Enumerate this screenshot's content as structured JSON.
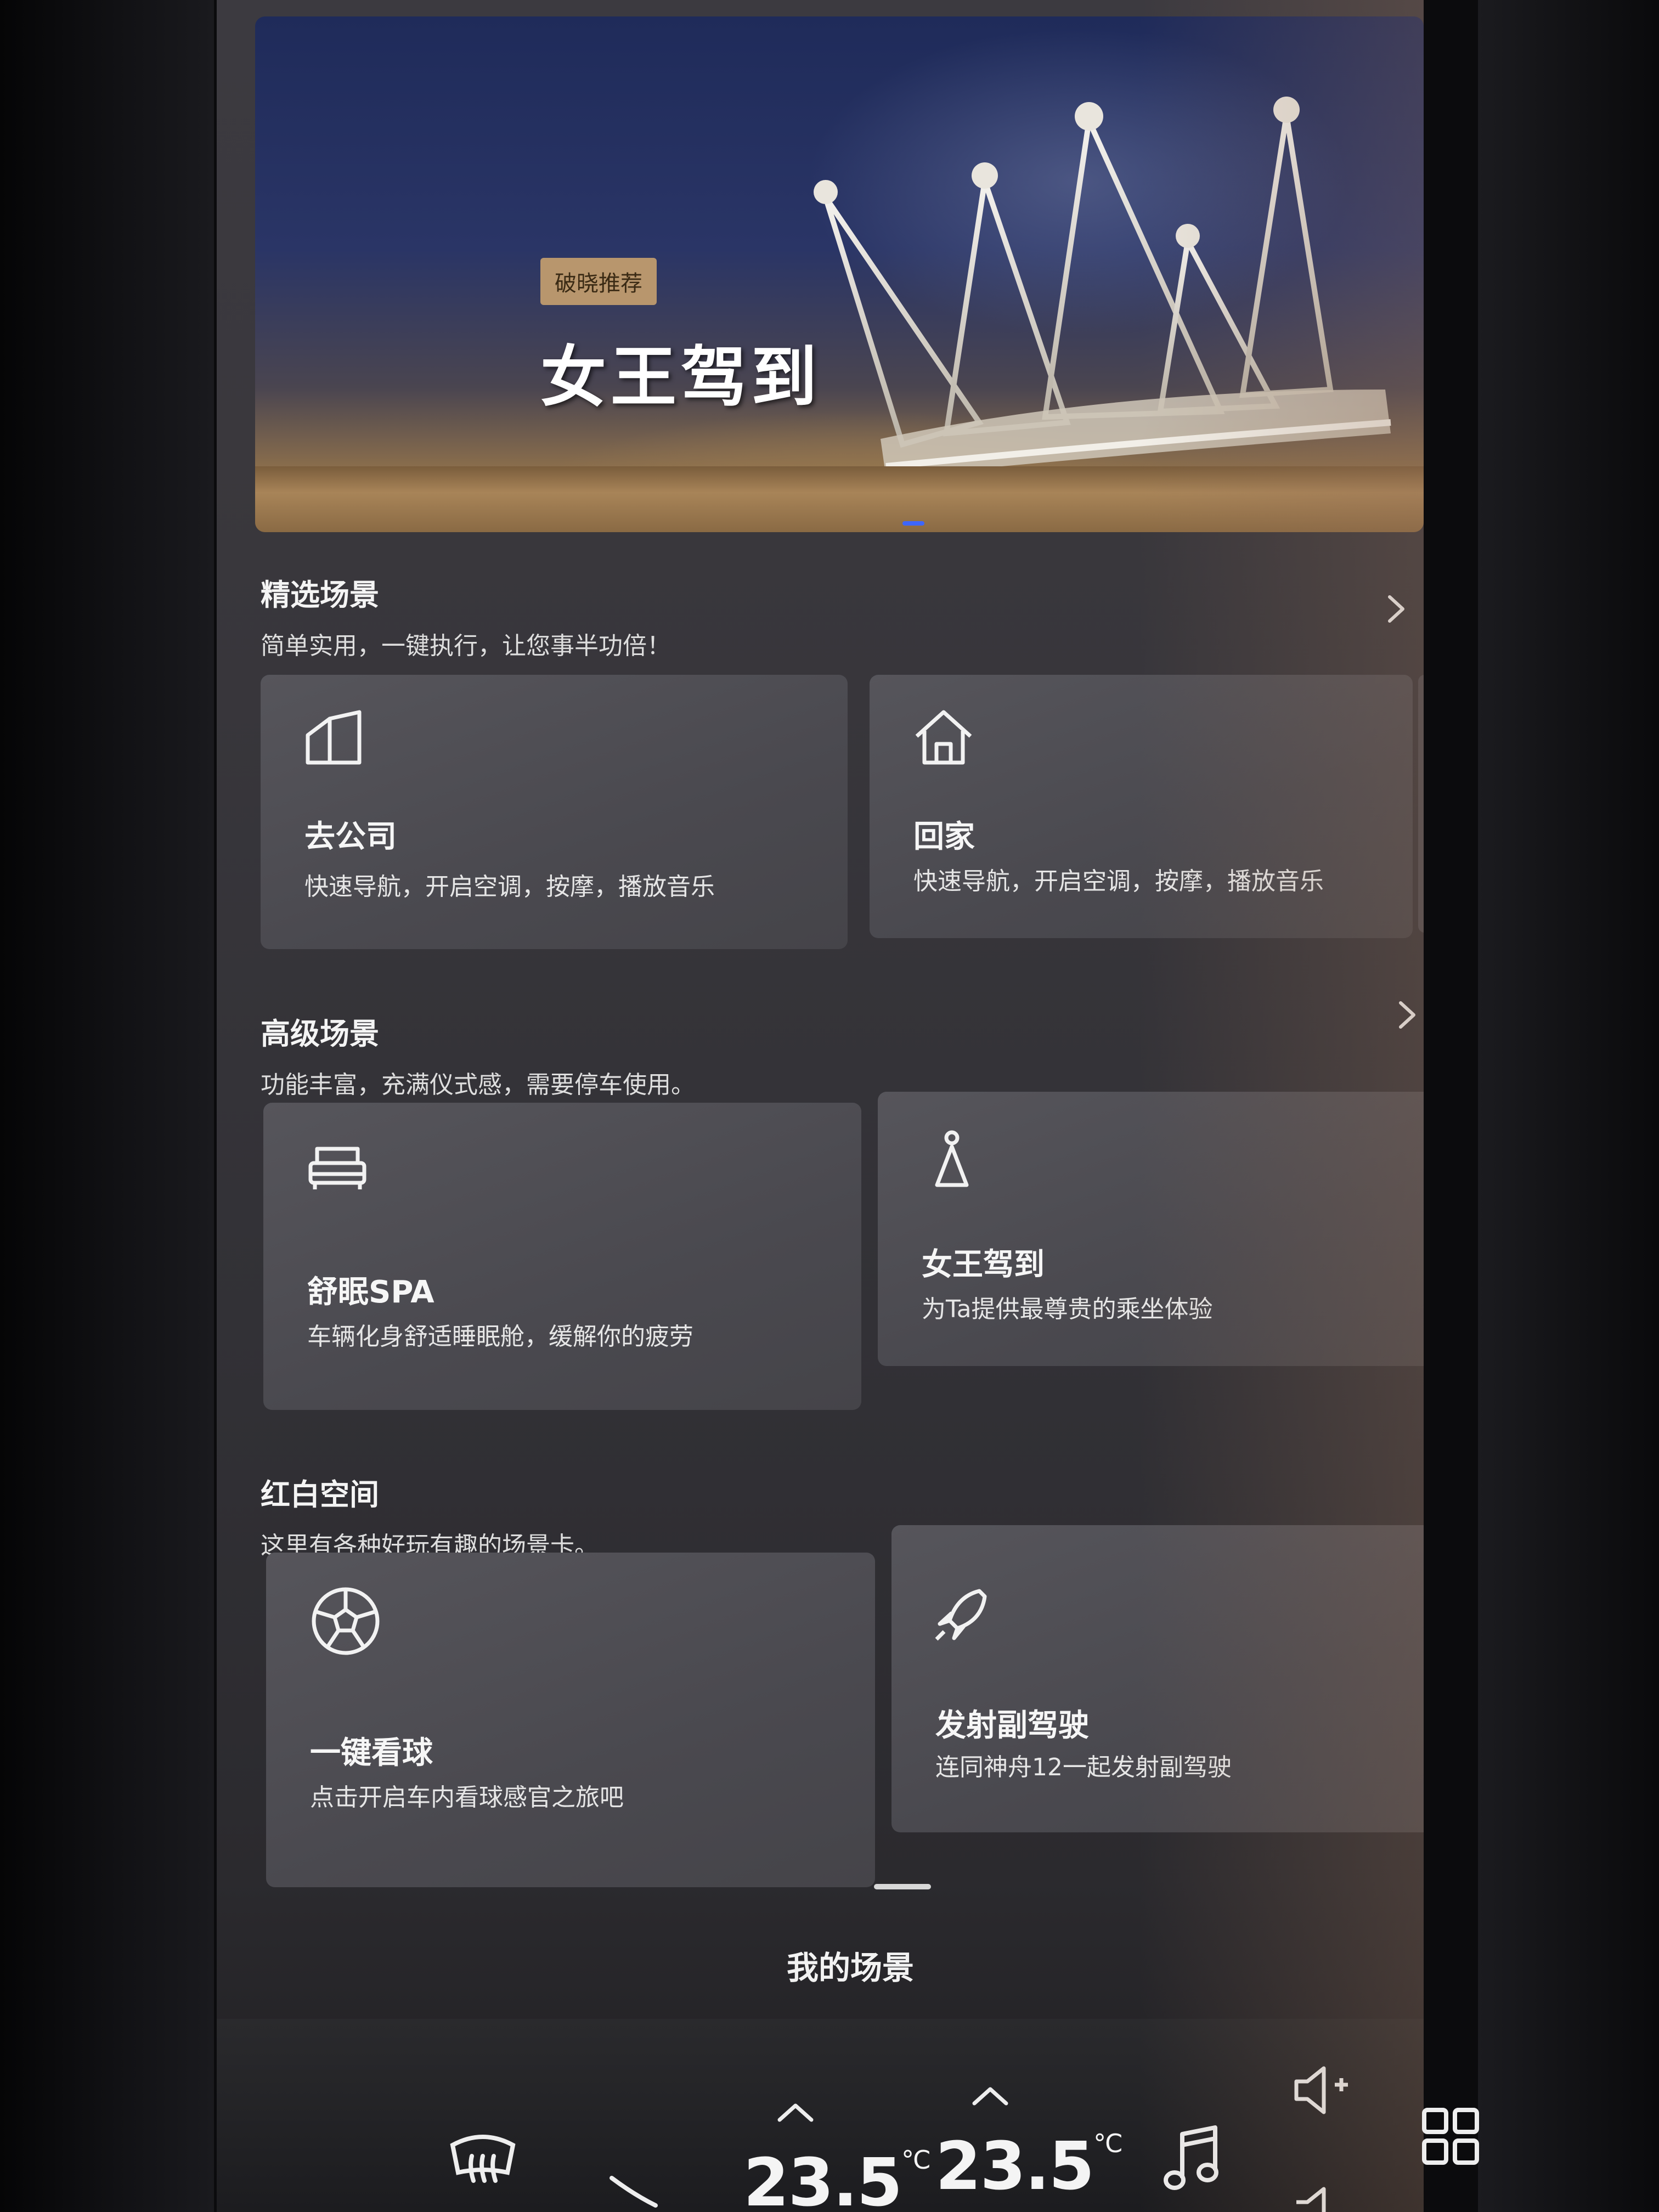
{
  "hero": {
    "badge": "破晓推荐",
    "title": "女王驾到"
  },
  "sections": [
    {
      "title": "精选场景",
      "subtitle": "简单实用，一键执行，让您事半功倍！",
      "cards": [
        {
          "icon": "office-building-icon",
          "title": "去公司",
          "desc": "快速导航，开启空调，按摩，播放音乐"
        },
        {
          "icon": "home-icon",
          "title": "回家",
          "desc": "快速导航，开启空调，按摩，播放音乐"
        }
      ]
    },
    {
      "title": "高级场景",
      "subtitle": "功能丰富，充满仪式感，需要停车使用。",
      "cards": [
        {
          "icon": "bed-icon",
          "title": "舒眠SPA",
          "desc": "车辆化身舒适睡眠舱，缓解你的疲劳"
        },
        {
          "icon": "queen-icon",
          "title": "女王驾到",
          "desc": "为Ta提供最尊贵的乘坐体验"
        }
      ]
    },
    {
      "title": "红白空间",
      "subtitle": "这里有各种好玩有趣的场景卡。",
      "cards": [
        {
          "icon": "soccer-ball-icon",
          "title": "一键看球",
          "desc": "点击开启车内看球感官之旅吧"
        },
        {
          "icon": "rocket-icon",
          "title": "发射副驾驶",
          "desc": "连同神舟12一起发射副驾驶"
        }
      ]
    }
  ],
  "bottom_sheet": {
    "label": "我的场景"
  },
  "dock": {
    "left_temp": "23.5",
    "right_temp": "23.5",
    "temp_unit": "°C"
  },
  "colors": {
    "screen_bg": "#3a383d",
    "card_bg": "#4e4d53",
    "badge_bg": "#b8966d",
    "accent_blue": "#3d66ff"
  }
}
